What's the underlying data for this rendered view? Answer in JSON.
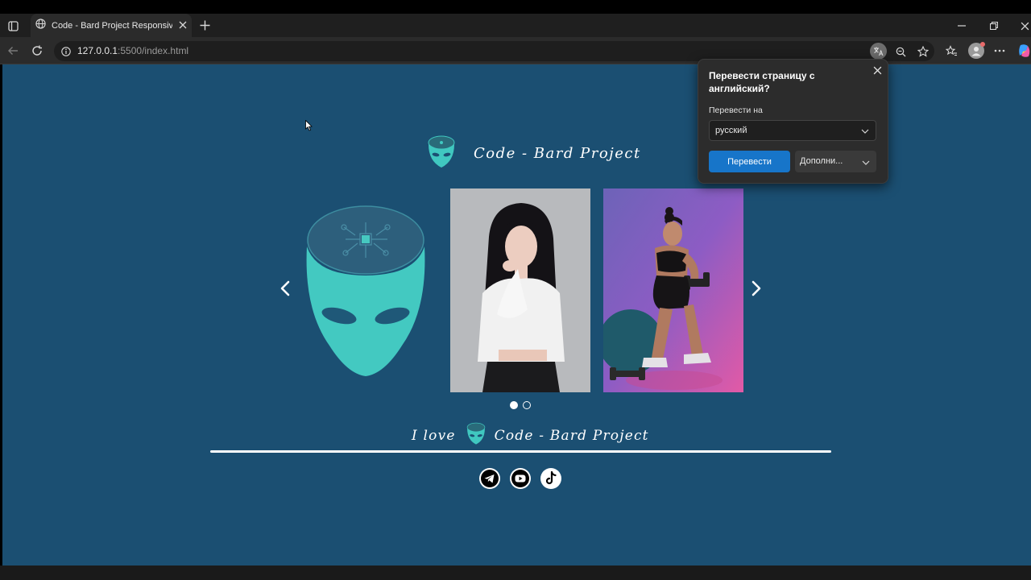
{
  "browser": {
    "tab_title": "Code - Bard Project Responsive C",
    "url_host": "127.0.0.1",
    "url_path": ":5500/index.html"
  },
  "page": {
    "brand_text": "Code - Bard Project",
    "footer_prefix": "I love",
    "footer_brand": "Code - Bard Project",
    "carousel": {
      "active_slide": 1,
      "total_dots": 2
    },
    "social": [
      "telegram-icon",
      "youtube-icon",
      "tiktok-icon"
    ]
  },
  "translate_popup": {
    "title": "Перевести страницу с английский?",
    "target_label": "Перевести на",
    "target_value": "русский",
    "translate_button": "Перевести",
    "more_button": "Дополни..."
  },
  "colors": {
    "page_bg": "#1b4f72",
    "accent_teal": "#40c8c0",
    "primary_button": "#1775c9"
  }
}
